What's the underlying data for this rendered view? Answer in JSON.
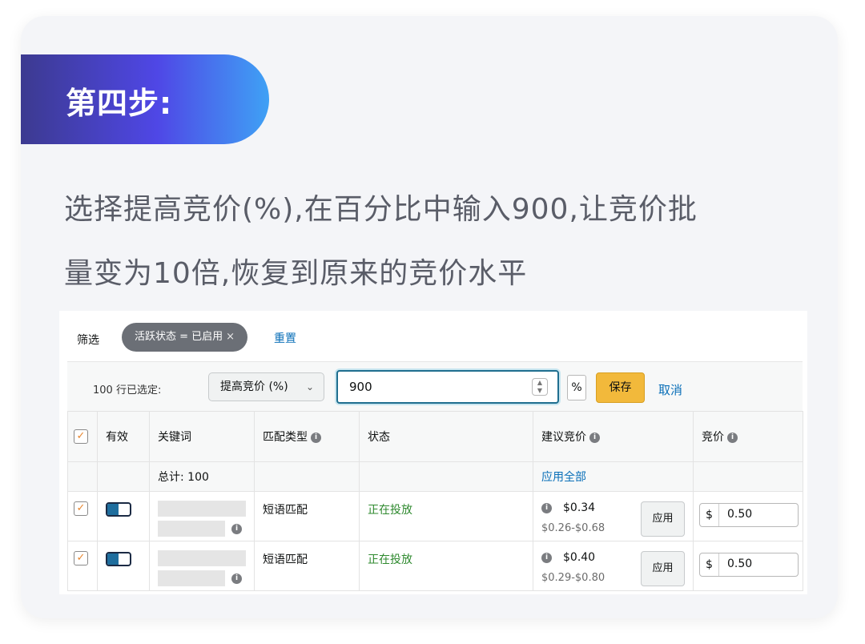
{
  "step": {
    "title": "第四步:"
  },
  "description": {
    "line1": "选择提高竞价(%),在百分比中输入900,让竞价批",
    "line2": "量变为10倍,恢复到原来的竞价水平"
  },
  "filter": {
    "label": "筛选",
    "chip": "活跃状态 = 已启用",
    "chip_close": "×",
    "reset": "重置"
  },
  "bulk": {
    "selected_count": "100 行已选定:",
    "action_select": "提高竞价 (%)",
    "value": "900",
    "unit": "%",
    "save": "保存",
    "cancel": "取消"
  },
  "table": {
    "headers": [
      "有效",
      "关键词",
      "匹配类型",
      "状态",
      "建议竞价",
      "竞价"
    ],
    "total": "总计: 100",
    "apply_all": "应用全部",
    "rows": [
      {
        "match": "短语匹配",
        "status": "正在投放",
        "suggested": "$0.34",
        "range": "$0.26-$0.68",
        "apply": "应用",
        "currency": "$",
        "bid": "0.50"
      },
      {
        "match": "短语匹配",
        "status": "正在投放",
        "suggested": "$0.40",
        "range": "$0.29-$0.80",
        "apply": "应用",
        "currency": "$",
        "bid": "0.50"
      }
    ]
  },
  "icons": {
    "info": "i",
    "check": "✓",
    "chevron": "⌄",
    "spin_up": "▲",
    "spin_down": "▼"
  },
  "colors": {
    "accent_gradient_start": "#3c3a90",
    "accent_gradient_end": "#3fa1f5",
    "save": "#f2b93b",
    "link": "#0a6fb8",
    "status": "#2f8a2f"
  }
}
